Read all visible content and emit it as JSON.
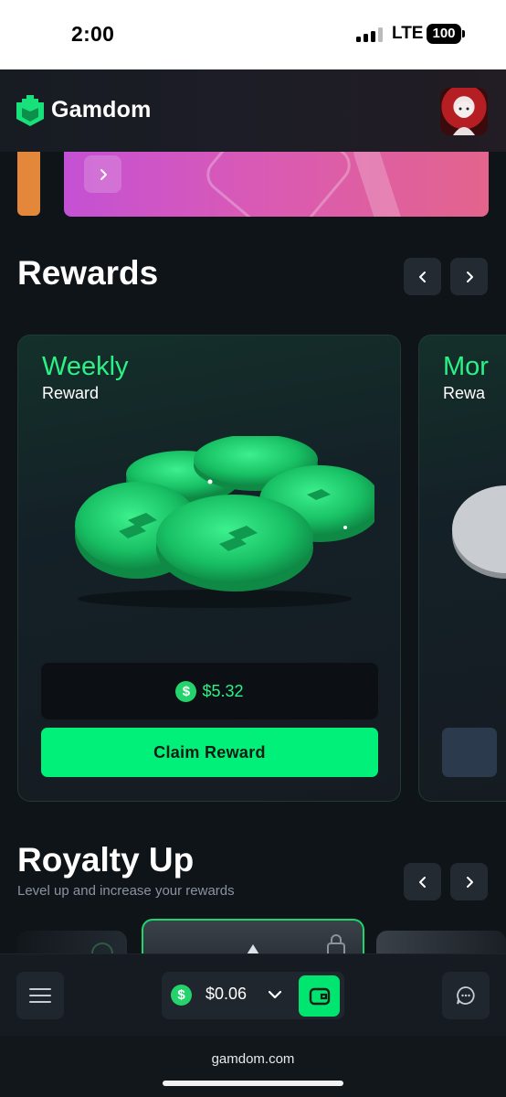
{
  "status_bar": {
    "time": "2:00",
    "network": "LTE",
    "battery": "100"
  },
  "header": {
    "brand": "Gamdom",
    "logo_icon": "gamdom-logo-icon",
    "avatar_icon": "user-avatar"
  },
  "rewards": {
    "title": "Rewards",
    "prev_icon": "chevron-left-icon",
    "next_icon": "chevron-right-icon",
    "cards": [
      {
        "title": "Weekly",
        "subtitle": "Reward",
        "currency_symbol": "$",
        "amount": "$5.32",
        "button_label": "Claim Reward"
      },
      {
        "title": "Mor",
        "subtitle": "Rewa"
      }
    ]
  },
  "royalty": {
    "title": "Royalty Up",
    "subtitle": "Level up and increase your rewards"
  },
  "bottom_bar": {
    "menu_icon": "hamburger-menu-icon",
    "currency_symbol": "$",
    "balance": "$0.06",
    "dropdown_icon": "chevron-down-icon",
    "wallet_icon": "wallet-icon",
    "chat_icon": "chat-bubble-icon"
  },
  "browser": {
    "url": "gamdom.com"
  },
  "colors": {
    "accent_green": "#00f07a",
    "text_green": "#2bf287",
    "background": "#0f1419",
    "card": "#151b21"
  }
}
